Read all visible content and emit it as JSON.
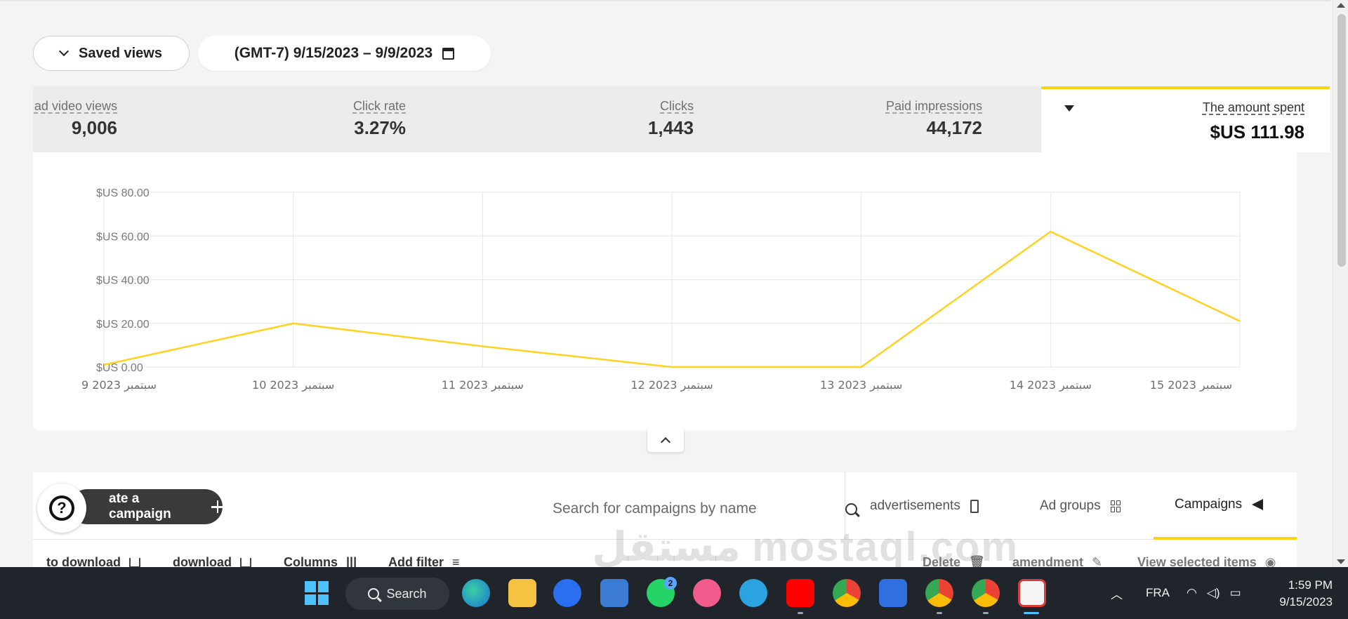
{
  "toolbar": {
    "saved_views": "Saved views",
    "date_range": "(GMT-7) 9/15/2023 – 9/9/2023"
  },
  "metrics": [
    {
      "label": "ad video views",
      "value": "9,006"
    },
    {
      "label": "Click rate",
      "value": "3.27%"
    },
    {
      "label": "Clicks",
      "value": "1,443"
    },
    {
      "label": "Paid impressions",
      "value": "44,172"
    }
  ],
  "active_metric": {
    "label": "The amount spent",
    "value": "$US 111.98"
  },
  "chart_data": {
    "type": "line",
    "x": [
      "9 سبتمبر 2023",
      "10 سبتمبر 2023",
      "11 سبتمبر 2023",
      "12 سبتمبر 2023",
      "13 سبتمبر 2023",
      "14 سبتمبر 2023",
      "15 سبتمبر 2023"
    ],
    "series": [
      {
        "values": [
          1,
          20,
          9.5,
          0,
          0,
          62,
          21
        ]
      }
    ],
    "yticks": [
      "$US 0.00",
      "$US 20.00",
      "$US 40.00",
      "$US 60.00",
      "$US 80.00"
    ],
    "ylim": [
      0,
      80
    ],
    "grid": true,
    "color": "#ffd21f"
  },
  "table": {
    "create_button": "ate a campaign",
    "search_placeholder": "Search for campaigns by name",
    "tabs": [
      {
        "label": "advertisements",
        "icon": "phone-icon"
      },
      {
        "label": "Ad groups",
        "icon": "grid-icon"
      },
      {
        "label": "Campaigns",
        "icon": "megaphone-icon"
      }
    ],
    "actions_left": [
      "to download",
      "download",
      "Columns",
      "Add filter"
    ],
    "actions_right": [
      "Delete",
      "amendment",
      "View selected items"
    ]
  },
  "watermark": "مستقل mostaql.com",
  "taskbar": {
    "search_label": "Search",
    "whatsapp_badge": "2",
    "language": "FRA",
    "time": "1:59 PM",
    "date": "9/15/2023"
  }
}
